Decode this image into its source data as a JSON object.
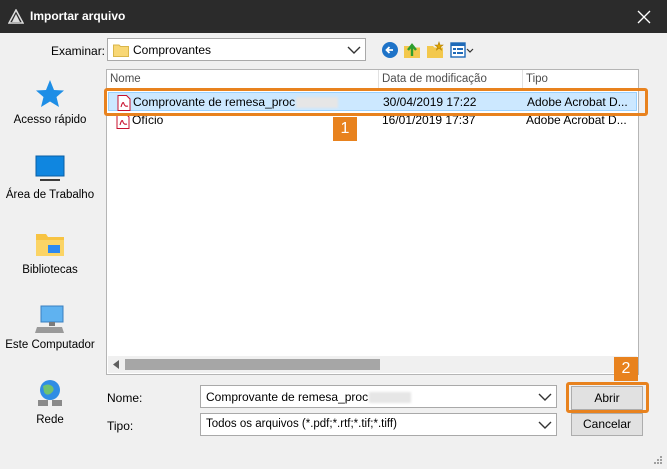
{
  "window": {
    "title": "Importar arquivo"
  },
  "lookin": {
    "label": "Examinar:",
    "value": "Comprovantes"
  },
  "places": [
    {
      "label": "Acesso rápido",
      "icon": "star-icon"
    },
    {
      "label": "Área de Trabalho",
      "icon": "desktop-icon"
    },
    {
      "label": "Bibliotecas",
      "icon": "libraries-icon"
    },
    {
      "label": "Este Computador",
      "icon": "computer-icon"
    },
    {
      "label": "Rede",
      "icon": "network-icon"
    }
  ],
  "columns": {
    "name": "Nome",
    "date": "Data de modificação",
    "type": "Tipo"
  },
  "files": [
    {
      "name": "Comprovante de remesa_proc",
      "date": "30/04/2019 17:22",
      "type": "Adobe Acrobat D...",
      "selected": true
    },
    {
      "name": "Ofício",
      "date": "16/01/2019 17:37",
      "type": "Adobe Acrobat D...",
      "selected": false
    }
  ],
  "filename": {
    "label": "Nome:",
    "value": "Comprovante de remesa_proc"
  },
  "filetype": {
    "label": "Tipo:",
    "value": "Todos os arquivos (*.pdf;*.rtf;*.tif;*.tiff)"
  },
  "buttons": {
    "open": "Abrir",
    "cancel": "Cancelar"
  },
  "annotations": [
    "1",
    "2"
  ],
  "colors": {
    "accent": "#e8821e",
    "selection": "#cce8ff",
    "titlebar": "#2b2b2b"
  }
}
